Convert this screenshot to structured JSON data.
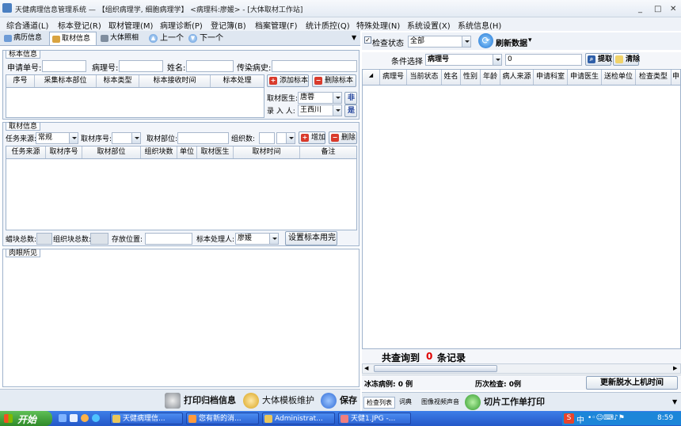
{
  "window": {
    "title": "天健病理信息管理系统 — 【组织病理学, 细胞病理学】 <病理科:廖媛> - [大体取材工作站]",
    "minimize": "_",
    "maximize": "□",
    "close": "✕"
  },
  "menu": [
    "综合通道(L)",
    "标本登记(R)",
    "取材管理(M)",
    "病理诊断(P)",
    "登记簿(B)",
    "档案管理(F)",
    "统计质控(Q)",
    "特殊处理(N)",
    "系统设置(X)",
    "系统信息(H)"
  ],
  "left_tabs": {
    "tabs": [
      "病历信息",
      "取材信息",
      "大体照相"
    ],
    "prev": "上一个",
    "next": "下一个"
  },
  "specimen": {
    "title": "标本信息",
    "apply_no_label": "申请单号:",
    "path_no_label": "病理号:",
    "name_label": "姓名:",
    "infectious_label": "传染病史:",
    "columns": [
      "序号",
      "采集标本部位",
      "标本类型",
      "标本接收时间",
      "标本处理"
    ],
    "add_button": "添加标本",
    "delete_button": "删除标本",
    "doctor_label": "取材医生:",
    "doctor_value": "唐蓉",
    "doctor_btn": "非",
    "recorder_label": "录 入 人:",
    "recorder_value": "王西川",
    "recorder_btn": "是"
  },
  "sampling": {
    "title": "取材信息",
    "source_label": "任务来源:",
    "source_value": "常规",
    "seq_label": "取材序号:",
    "site_label": "取材部位:",
    "count_label": "组织数:",
    "add_button": "增加",
    "delete_button": "删除",
    "columns": [
      "任务来源",
      "取材序号",
      "取材部位",
      "组织块数",
      "单位",
      "取材医生",
      "取材时间",
      "备注"
    ],
    "wax_total_label": "蜡块总数:",
    "tissue_total_label": "组织块总数:",
    "storage_label": "存放位置:",
    "handler_label": "标本处理人:",
    "handler_value": "廖媛",
    "finish_button": "设置标本用完"
  },
  "gross": {
    "title": "肉眼所见"
  },
  "left_footer": {
    "print": "打印归档信息",
    "template": "大体模板维护",
    "save": "保存"
  },
  "right_toolbar": {
    "status_label": "检查状态",
    "status_value": "全部",
    "refresh": "刷新数据",
    "refresh_arrow": "▾"
  },
  "right_condition": {
    "label": "条件选择",
    "field": "病理号",
    "value": "0",
    "search": "提取",
    "clear": "清除"
  },
  "right_grid": {
    "columns": [
      "病理号",
      "当前状态",
      "姓名",
      "性别",
      "年龄",
      "病人来源",
      "申请科室",
      "申请医生",
      "送检单位",
      "检查类型",
      "申"
    ]
  },
  "count": {
    "prefix": "共查询到",
    "value": "0",
    "suffix": "条记录"
  },
  "right_info": {
    "frozen": "冰冻病例: 0 例",
    "history": "历次检查: 0例",
    "update_button": "更新脱水上机时间"
  },
  "right_tabs": [
    "检查列表",
    "词典",
    "图像视频声音"
  ],
  "print_sheet": "切片工作单打印",
  "taskbar": {
    "start": "开始",
    "tasks": [
      "天健病理信...",
      "您有新的消...",
      "Administrat...",
      "天健1.JPG -..."
    ],
    "ime": "中",
    "time": "8:59"
  },
  "colors": {
    "accent": "#2f6bd6",
    "count_red": "#e00000",
    "taskbar": "#2458c8"
  }
}
